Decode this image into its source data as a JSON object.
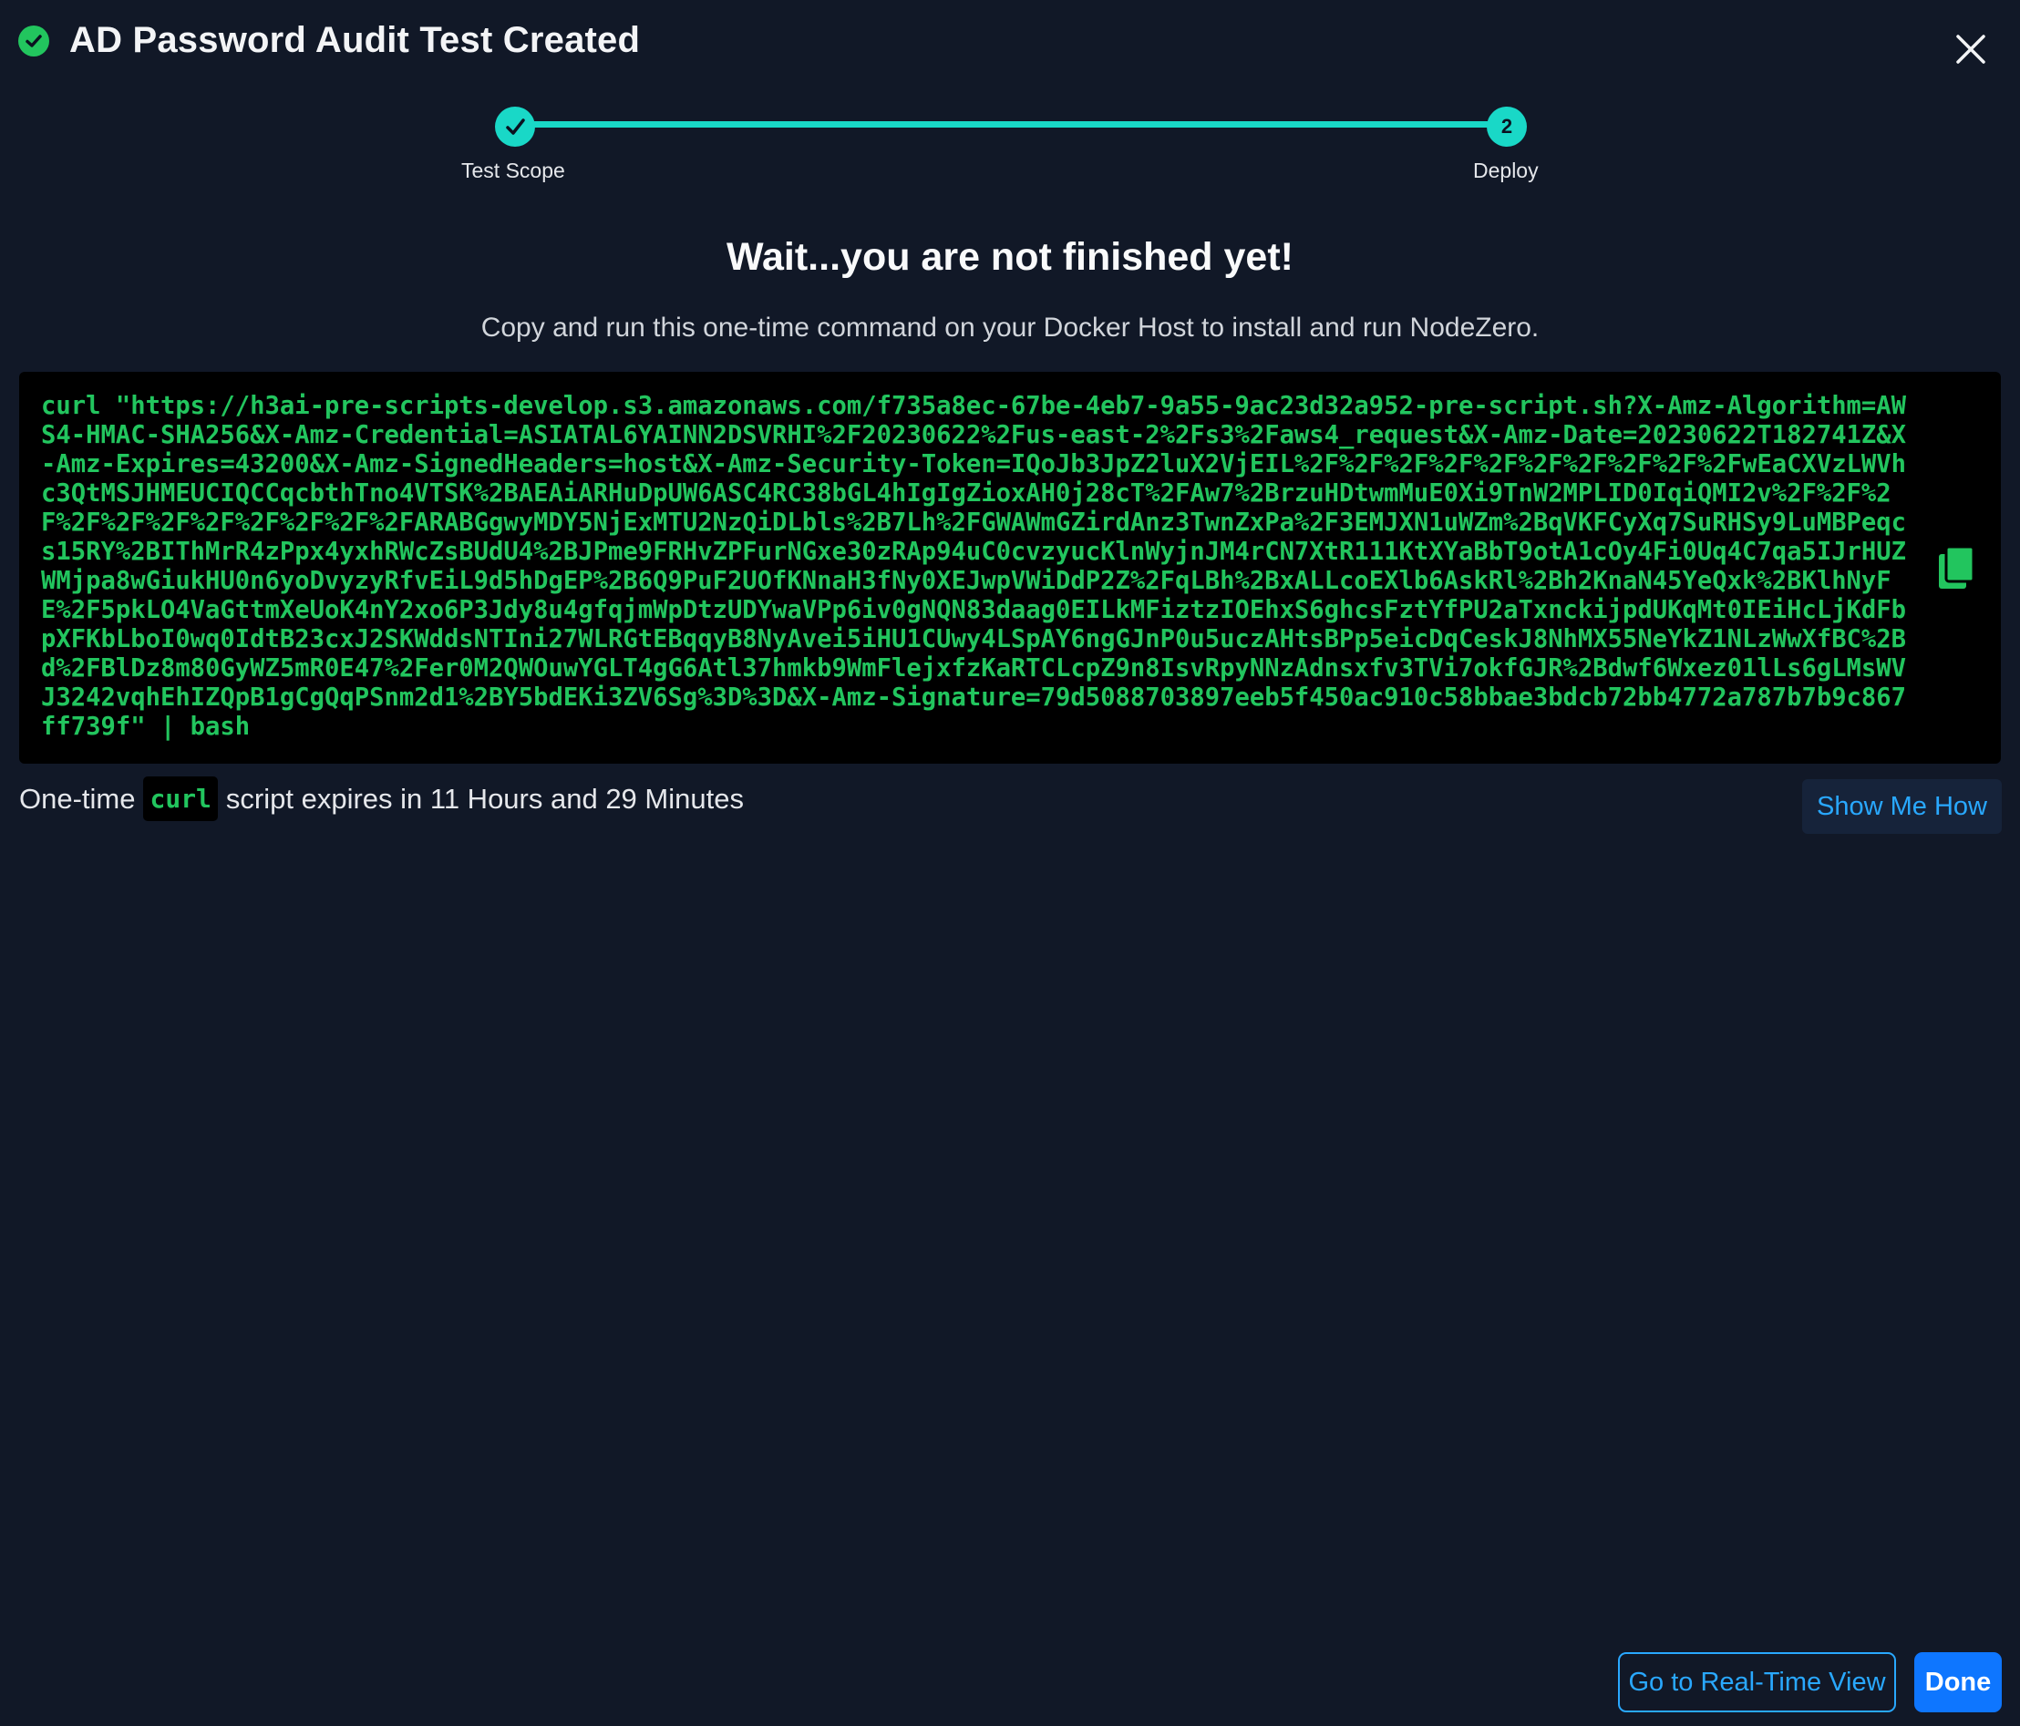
{
  "header": {
    "title": "AD Password Audit Test Created",
    "status_icon": "check-circle-icon",
    "close_icon": "close-icon"
  },
  "stepper": {
    "steps": [
      {
        "label": "Test Scope",
        "indicator": "✓",
        "state": "complete"
      },
      {
        "label": "Deploy",
        "indicator": "2",
        "state": "current"
      }
    ]
  },
  "main": {
    "heading": "Wait...you are not finished yet!",
    "subheading": "Copy and run this one-time command on your Docker Host to install and run NodeZero.",
    "command": "curl \"https://h3ai-pre-scripts-develop.s3.amazonaws.com/f735a8ec-67be-4eb7-9a55-9ac23d32a952-pre-script.sh?X-Amz-Algorithm=AWS4-HMAC-SHA256&X-Amz-Credential=ASIATAL6YAINN2DSVRHI%2F20230622%2Fus-east-2%2Fs3%2Faws4_request&X-Amz-Date=20230622T182741Z&X-Amz-Expires=43200&X-Amz-SignedHeaders=host&X-Amz-Security-Token=IQoJb3JpZ2luX2VjEIL%2F%2F%2F%2F%2F%2F%2F%2F%2F%2FwEaCXVzLWVhc3QtMSJHMEUCIQCCqcbthTno4VTSK%2BAEAiARHuDpUW6ASC4RC38bGL4hIgIgZioxAH0j28cT%2FAw7%2BrzuHDtwmMuE0Xi9TnW2MPLID0IqiQMI2v%2F%2F%2F%2F%2F%2F%2F%2F%2F%2F%2FARABGgwyMDY5NjExMTU2NzQiDLbls%2B7Lh%2FGWAWmGZirdAnz3TwnZxPa%2F3EMJXN1uWZm%2BqVKFCyXq7SuRHSy9LuMBPeqcs15RY%2BIThMrR4zPpx4yxhRWcZsBUdU4%2BJPme9FRHvZPFurNGxe30zRAp94uC0cvzyucKlnWyjnJM4rCN7XtR111KtXYaBbT9otA1cOy4Fi0Uq4C7qa5IJrHUZWMjpa8wGiukHU0n6yoDvyzyRfvEiL9d5hDgEP%2B6Q9PuF2UOfKNnaH3fNy0XEJwpVWiDdP2Z%2FqLBh%2BxALLcoEXlb6AskRl%2Bh2KnaN45YeQxk%2BKlhNyFE%2F5pkLO4VaGttmXeUoK4nY2xo6P3Jdy8u4gfqjmWpDtzUDYwaVPp6iv0gNQN83daag0EILkMFiztzIOEhxS6ghcsFztYfPU2aTxnckijpdUKqMt0IEiHcLjKdFbpXFKbLboI0wq0IdtB23cxJ2SKWddsNTIni27WLRGtEBqqyB8NyAvei5iHU1CUwy4LSpAY6ngGJnP0u5uczAHtsBPp5eicDqCeskJ8NhMX55NeYkZ1NLzWwXfBC%2Bd%2FBlDz8m80GyWZ5mR0E47%2Fer0M2QWOuwYGLT4gG6Atl37hmkb9WmFlejxfzKaRTCLcpZ9n8IsvRpyNNzAdnsxfv3TVi7okfGJR%2Bdwf6Wxez01lLs6gLMsWVJ3242vqhEhIZQpB1gCgQqPSnm2d1%2BY5bdEKi3ZV6Sg%3D%3D&X-Amz-Signature=79d5088703897eeb5f450ac910c58bbae3bdcb72bb4772a787b7b9c867ff739f\" | bash",
    "copy_icon": "copy-icon"
  },
  "expiry": {
    "prefix": "One-time",
    "chip": "curl",
    "suffix": "script expires in 11 Hours and 29 Minutes"
  },
  "help_button": "Show Me How",
  "footer": {
    "realtime_label": "Go to Real-Time View",
    "done_label": "Done"
  },
  "colors": {
    "background": "#111827",
    "accent_teal": "#19d8c7",
    "success_green": "#22c55e",
    "link_blue": "#29a8ff",
    "primary_blue": "#0e76ff"
  }
}
